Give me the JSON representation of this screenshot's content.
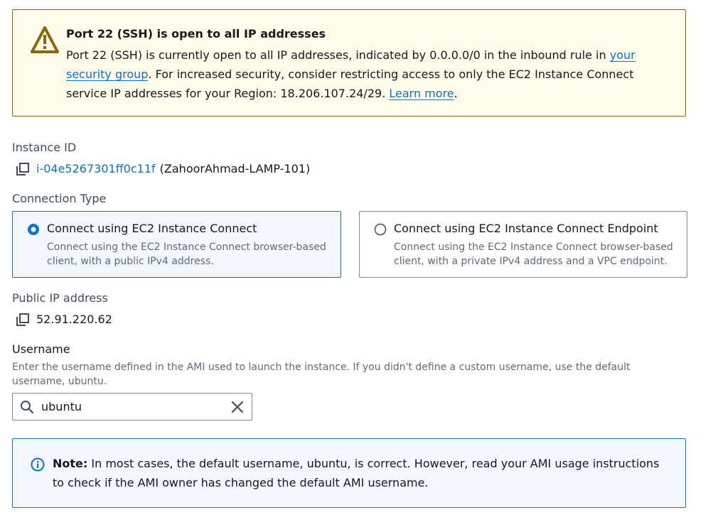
{
  "warning": {
    "title": "Port 22 (SSH) is open to all IP addresses",
    "text_1": "Port 22 (SSH) is currently open to all IP addresses, indicated by 0.0.0.0/0 in the inbound rule in ",
    "link_security_group": "your security group",
    "text_2": ". For increased security, consider restricting access to only the EC2 Instance Connect service IP addresses for your Region: 18.206.107.24/29. ",
    "link_learn_more": "Learn more",
    "text_3": "."
  },
  "instance": {
    "label": "Instance ID",
    "id": "i-04e5267301ff0c11f",
    "name": "(ZahoorAhmad-LAMP-101)"
  },
  "connection": {
    "label": "Connection Type",
    "options": [
      {
        "title": "Connect using EC2 Instance Connect",
        "description": "Connect using the EC2 Instance Connect browser-based client, with a public IPv4 address.",
        "selected": true
      },
      {
        "title": "Connect using EC2 Instance Connect Endpoint",
        "description": "Connect using the EC2 Instance Connect browser-based client, with a private IPv4 address and a VPC endpoint.",
        "selected": false
      }
    ]
  },
  "public_ip": {
    "label": "Public IP address",
    "value": "52.91.220.62"
  },
  "username": {
    "label": "Username",
    "description": "Enter the username defined in the AMI used to launch the instance. If you didn't define a custom username, use the default username, ubuntu.",
    "value": "ubuntu"
  },
  "note": {
    "label": "Note:",
    "text": " In most cases, the default username, ubuntu, is correct. However, read your AMI usage instructions to check if the AMI owner has changed the default AMI username."
  },
  "icons": {
    "warning": "warning-icon",
    "copy": "copy-icon",
    "search": "search-icon",
    "clear": "close-icon",
    "info": "info-icon"
  },
  "colors": {
    "link": "#0972d3",
    "warning_bg": "#fffce9",
    "warning_border": "#8d6605",
    "info_bg": "#f2f8fd",
    "info_border": "#0972d3"
  }
}
